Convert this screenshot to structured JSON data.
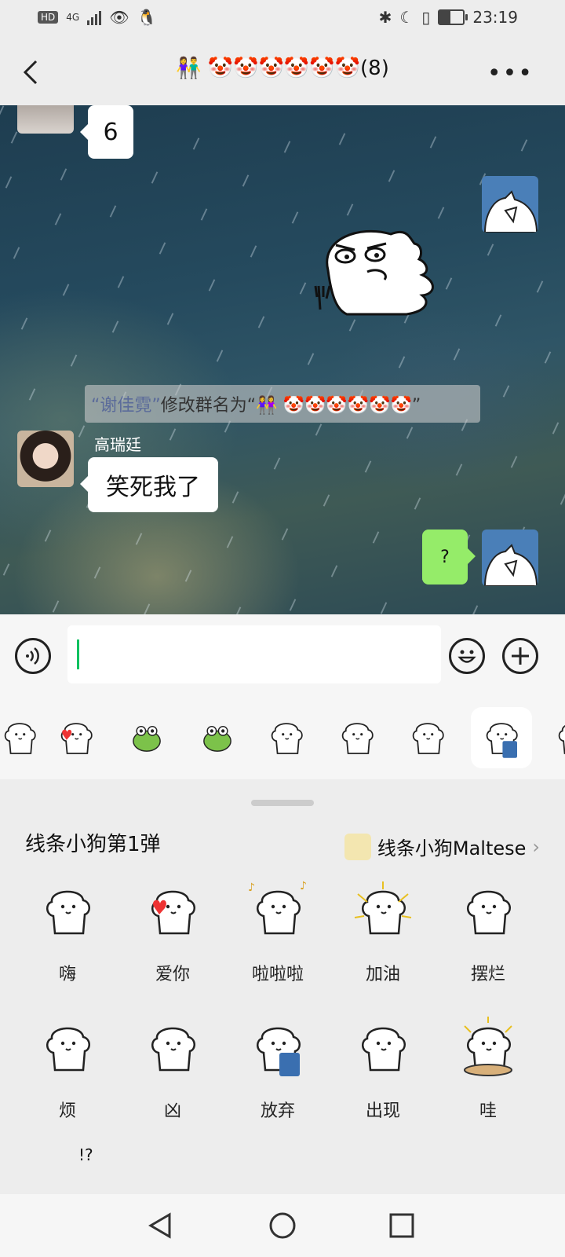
{
  "status_bar": {
    "network": "4G",
    "hd": "HD",
    "time": "23:19",
    "battery_level": 0.45
  },
  "header": {
    "title": "👫 🤡🤡🤡🤡🤡🤡(8)",
    "more_label": "•••"
  },
  "messages": [
    {
      "side": "left",
      "text": "6"
    },
    {
      "side": "right",
      "kind": "sticker",
      "sticker": "dino-fork-sticker"
    },
    {
      "kind": "system",
      "name": "“谢佳霓”",
      "text": "修改群名为“👭 🤡🤡🤡🤡🤡🤡”"
    },
    {
      "side": "left",
      "sender": "高瑞廷",
      "text": "笑死我了"
    },
    {
      "side": "right",
      "text": "?"
    }
  ],
  "sticker_panel": {
    "pack_title": "线条小狗第1弹",
    "pack_link": "线条小狗Maltese",
    "stickers": [
      {
        "label": "嗨",
        "icon": "dog-hi-icon"
      },
      {
        "label": "爱你",
        "icon": "dog-heart-icon"
      },
      {
        "label": "啦啦啦",
        "icon": "dog-dance-icon"
      },
      {
        "label": "加油",
        "icon": "dog-cheer-icon"
      },
      {
        "label": "摆烂",
        "icon": "dog-lie-icon"
      },
      {
        "label": "烦",
        "icon": "dog-annoyed-icon"
      },
      {
        "label": "凶",
        "icon": "dog-fierce-icon"
      },
      {
        "label": "放弃",
        "icon": "dog-trash-icon"
      },
      {
        "label": "出现",
        "icon": "dog-appear-icon"
      },
      {
        "label": "哇",
        "icon": "dog-wow-icon"
      }
    ],
    "partial_row_text": "!?"
  },
  "colors": {
    "accent": "#07c160",
    "own_bubble": "#95ec69",
    "chat_bg": "#254a5e"
  }
}
